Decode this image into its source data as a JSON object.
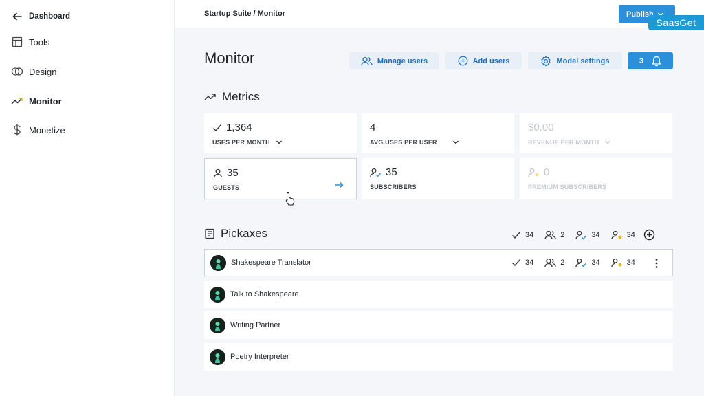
{
  "sidebar": {
    "back_label": "Dashboard",
    "items": [
      {
        "label": "Tools",
        "icon": "layout-icon"
      },
      {
        "label": "Design",
        "icon": "circles-icon"
      },
      {
        "label": "Monitor",
        "icon": "trend-icon",
        "active": true
      },
      {
        "label": "Monetize",
        "icon": "dollar-icon"
      }
    ]
  },
  "topbar": {
    "breadcrumb": "Startup Suite / Monitor",
    "publish_label": "Publish",
    "watermark": "SaasGet"
  },
  "header": {
    "title": "Monitor",
    "buttons": {
      "manage_users": "Manage users",
      "add_users": "Add users",
      "model_settings": "Model settings"
    },
    "notification_count": "3"
  },
  "metrics": {
    "title": "Metrics",
    "cards": [
      {
        "value": "1,364",
        "label": "USES PER MONTH"
      },
      {
        "value": "4",
        "label": "AVG USES PER USER"
      },
      {
        "value": "$0.00",
        "label": "REVENUE PER MONTH"
      },
      {
        "value": "35",
        "label": "GUESTS"
      },
      {
        "value": "35",
        "label": "SUBSCRIBERS"
      },
      {
        "value": "0",
        "label": "PREMIUM SUBSCRIBERS"
      }
    ]
  },
  "pickaxes": {
    "title": "Pickaxes",
    "totals": {
      "uses": "34",
      "users": "2",
      "subscribers": "34",
      "premium": "34"
    },
    "rows": [
      {
        "name": "Shakespeare Translator",
        "uses": "34",
        "users": "2",
        "subscribers": "34",
        "premium": "34"
      },
      {
        "name": "Talk to Shakespeare"
      },
      {
        "name": "Writing Partner"
      },
      {
        "name": "Poetry Interpreter"
      }
    ]
  },
  "colors": {
    "accent": "#2b8fd9",
    "button_bg": "#e8eff7",
    "button_text": "#1f6fb8",
    "premium": "#f2b705"
  }
}
